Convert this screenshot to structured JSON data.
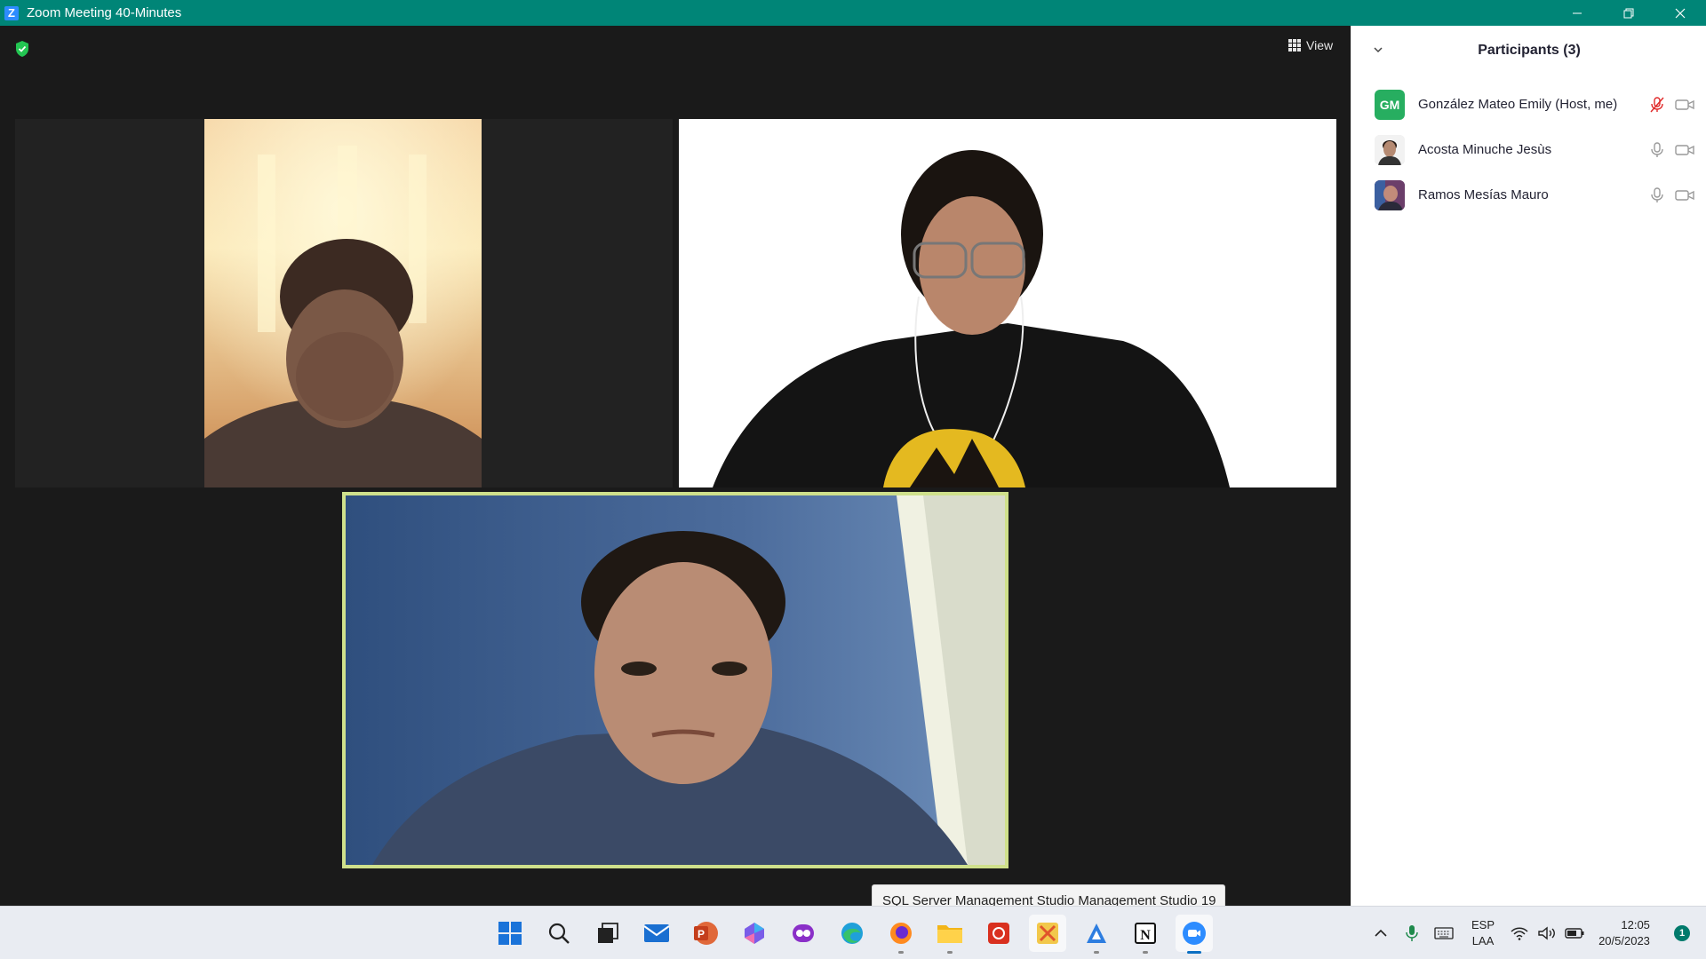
{
  "window": {
    "title": "Zoom Meeting 40-Minutes",
    "controls": [
      "minimize",
      "restore",
      "close"
    ]
  },
  "toolbar": {
    "view_label": "View"
  },
  "panel": {
    "title": "Participants (3)",
    "participants": [
      {
        "initials": "GM",
        "name": "González Mateo Emily (Host, me)",
        "avatar_color": "#27ae60",
        "mic": "muted",
        "video": "off"
      },
      {
        "initials": "",
        "name": "Acosta Minuche Jesùs",
        "mic": "on",
        "video": "off"
      },
      {
        "initials": "",
        "name": "Ramos Mesías Mauro",
        "mic": "on",
        "video": "off"
      }
    ]
  },
  "tooltip": {
    "text": "SQL Server Management Studio Management Studio 19"
  },
  "taskbar": {
    "apps": [
      "windows-start",
      "search",
      "task-view",
      "mail",
      "powerpoint",
      "copilot",
      "app-purple",
      "edge",
      "firefox",
      "file-explorer",
      "app-red",
      "app-colored",
      "app-blue",
      "notion",
      "zoom"
    ],
    "lang_line1": "ESP",
    "lang_line2": "LAA",
    "time": "12:05",
    "date": "20/5/2023",
    "notifications": "1"
  },
  "colors": {
    "titlebar": "#008577",
    "active_speaker_border": "#cfe08b",
    "meeting_bg": "#1a1a1a"
  }
}
